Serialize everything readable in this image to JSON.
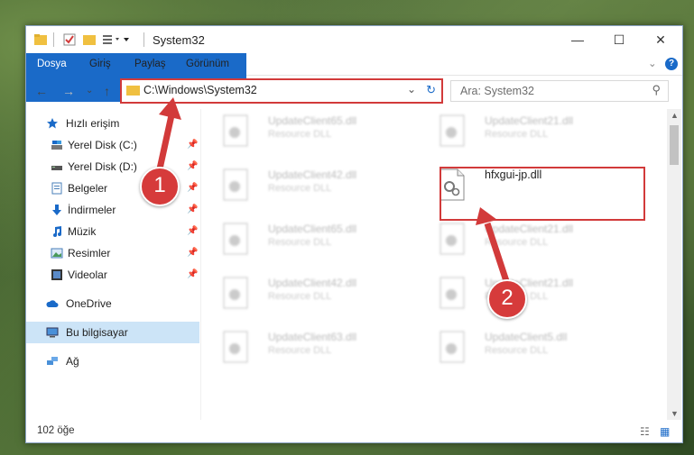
{
  "window": {
    "title": "System32",
    "minimize_label": "—",
    "maximize_label": "☐",
    "close_label": "✕"
  },
  "ribbon": {
    "tabs": [
      "Dosya",
      "Giriş",
      "Paylaş",
      "Görünüm"
    ]
  },
  "address": {
    "path": "C:\\Windows\\System32"
  },
  "search": {
    "placeholder": "Ara: System32"
  },
  "sidebar": {
    "quick_access": "Hızlı erişim",
    "items": [
      {
        "label": "Yerel Disk (C:)"
      },
      {
        "label": "Yerel Disk (D:)"
      },
      {
        "label": "Belgeler"
      },
      {
        "label": "İndirmeler"
      },
      {
        "label": "Müzik"
      },
      {
        "label": "Resimler"
      },
      {
        "label": "Videolar"
      }
    ],
    "onedrive": "OneDrive",
    "this_pc": "Bu bilgisayar",
    "network": "Ağ"
  },
  "files": [
    {
      "name": "UpdateClient65.dll",
      "type": "Resource DLL"
    },
    {
      "name": "UpdateClient21.dll",
      "type": "Resource DLL"
    },
    {
      "name": "UpdateClient42.dll",
      "type": "Resource DLL"
    },
    {
      "name": "hfxgui-jp.dll",
      "type": ""
    },
    {
      "name": "UpdateClient65.dll",
      "type": "Resource DLL"
    },
    {
      "name": "UpdateClient21.dll",
      "type": "Resource DLL"
    },
    {
      "name": "UpdateClient42.dll",
      "type": "Resource DLL"
    },
    {
      "name": "UpdateClient21.dll",
      "type": "Resource DLL"
    },
    {
      "name": "UpdateClient63.dll",
      "type": "Resource DLL"
    },
    {
      "name": "UpdateClient5.dll",
      "type": "Resource DLL"
    }
  ],
  "status": {
    "count": "102 öğe"
  },
  "annotations": {
    "badge1": "1",
    "badge2": "2",
    "accent": "#d23a3a"
  }
}
